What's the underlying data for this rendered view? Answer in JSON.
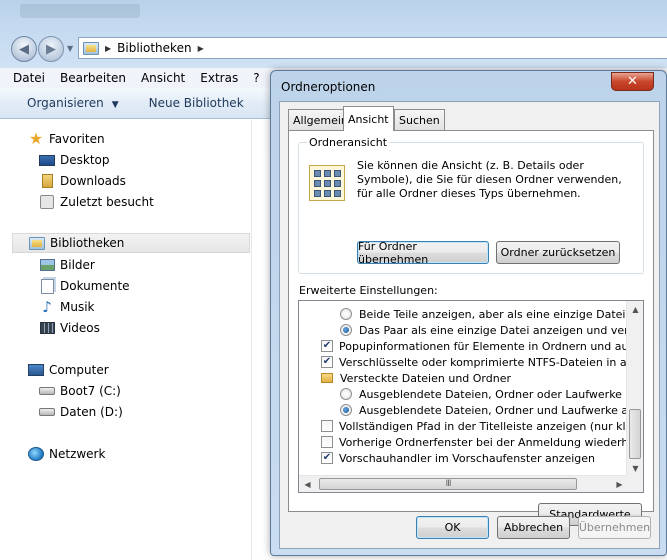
{
  "explorer": {
    "address": {
      "crumb": "Bibliotheken"
    },
    "menu": [
      "Datei",
      "Bearbeiten",
      "Ansicht",
      "Extras",
      "?"
    ],
    "toolbar": {
      "organize": "Organisieren",
      "new_library": "Neue Bibliothek"
    },
    "nav": {
      "favorites": {
        "label": "Favoriten",
        "items": [
          "Desktop",
          "Downloads",
          "Zuletzt besucht"
        ]
      },
      "libraries": {
        "label": "Bibliotheken",
        "items": [
          "Bilder",
          "Dokumente",
          "Musik",
          "Videos"
        ]
      },
      "computer": {
        "label": "Computer",
        "items": [
          "Boot7 (C:)",
          "Daten (D:)"
        ]
      },
      "network": {
        "label": "Netzwerk"
      }
    }
  },
  "dialog": {
    "title": "Ordneroptionen",
    "close_glyph": "✕",
    "tabs": [
      "Allgemein",
      "Ansicht",
      "Suchen"
    ],
    "active_tab": "Ansicht",
    "folder_view": {
      "label": "Ordneransicht",
      "description": "Sie können die Ansicht (z. B. Details oder Symbole), die Sie für diesen Ordner verwenden, für alle Ordner dieses Typs übernehmen.",
      "apply_button": "Für Ordner übernehmen",
      "reset_button": "Ordner zurücksetzen"
    },
    "advanced": {
      "label": "Erweiterte Einstellungen:",
      "rows": [
        {
          "kind": "radio",
          "checked": false,
          "indent": 1,
          "text": "Beide Teile anzeigen, aber als eine einzige Datei verwa"
        },
        {
          "kind": "radio",
          "checked": true,
          "indent": 1,
          "text": "Das Paar als eine einzige Datei anzeigen und verwalter"
        },
        {
          "kind": "checkbox",
          "checked": true,
          "indent": 0,
          "text": "Popupinformationen für Elemente in Ordnern und auf dem D"
        },
        {
          "kind": "checkbox",
          "checked": true,
          "indent": 0,
          "text": "Verschlüsselte oder komprimierte NTFS-Dateien in anderer"
        },
        {
          "kind": "folder",
          "checked": false,
          "indent": 0,
          "text": "Versteckte Dateien und Ordner"
        },
        {
          "kind": "radio",
          "checked": false,
          "indent": 1,
          "text": "Ausgeblendete Dateien, Ordner oder Laufwerke nicht a"
        },
        {
          "kind": "radio",
          "checked": true,
          "indent": 1,
          "text": "Ausgeblendete Dateien, Ordner und Laufwerke anzeig"
        },
        {
          "kind": "checkbox",
          "checked": false,
          "indent": 0,
          "text": "Vollständigen Pfad in der Titelleiste anzeigen (nur klassisch"
        },
        {
          "kind": "checkbox",
          "checked": false,
          "indent": 0,
          "text": "Vorherige Ordnerfenster bei der Anmeldung wiederherstellen"
        },
        {
          "kind": "checkbox",
          "checked": true,
          "indent": 0,
          "text": "Vorschauhandler im Vorschaufenster anzeigen"
        }
      ],
      "restore_defaults": "Standardwerte"
    },
    "buttons": {
      "ok": "OK",
      "cancel": "Abbrechen",
      "apply": "Übernehmen"
    }
  }
}
